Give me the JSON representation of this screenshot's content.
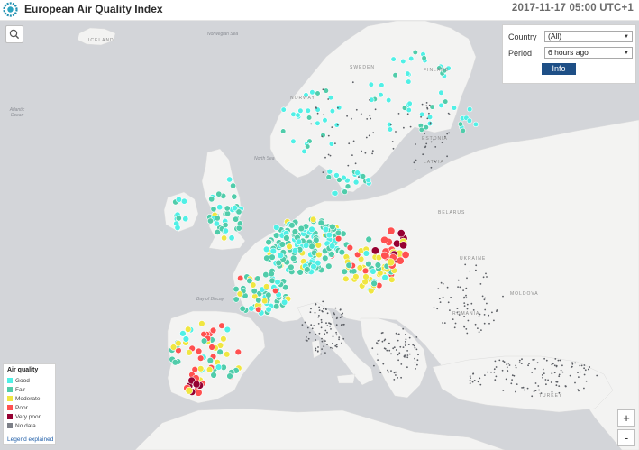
{
  "header": {
    "title": "European Air Quality Index",
    "timestamp": "2017-11-17 05:00 UTC+1"
  },
  "filters": {
    "country_label": "Country",
    "country_value": "(All)",
    "period_label": "Period",
    "period_value": "6 hours ago",
    "info_label": "Info"
  },
  "legend": {
    "title": "Air quality",
    "items": [
      {
        "label": "Good",
        "color": "#50f0e6"
      },
      {
        "label": "Fair",
        "color": "#50ccaa"
      },
      {
        "label": "Moderate",
        "color": "#f0e641"
      },
      {
        "label": "Poor",
        "color": "#ff5050"
      },
      {
        "label": "Very poor",
        "color": "#960032"
      },
      {
        "label": "No data",
        "color": "#7d8088"
      }
    ],
    "link": "Legend explained"
  },
  "zoom": {
    "in": "+",
    "out": "-"
  },
  "map_labels": {
    "countries": [
      "ICELAND",
      "SWEDEN",
      "FINLAND",
      "NORWAY",
      "ESTONIA",
      "LATVIA",
      "BELARUS",
      "UKRAINE",
      "MOLDOVA",
      "ROMANIA",
      "TURKEY"
    ],
    "seas": [
      "Atlantic Ocean",
      "North Sea",
      "Bay of Biscay",
      "Norwegian Sea"
    ]
  },
  "colors": {
    "sea": "#d3d5d9",
    "land": "#f3f3f2",
    "good": "#50f0e6",
    "fair": "#50ccaa",
    "moderate": "#f0e641",
    "poor": "#ff5050",
    "very_poor": "#960032",
    "no_data": "#5a5d63"
  }
}
